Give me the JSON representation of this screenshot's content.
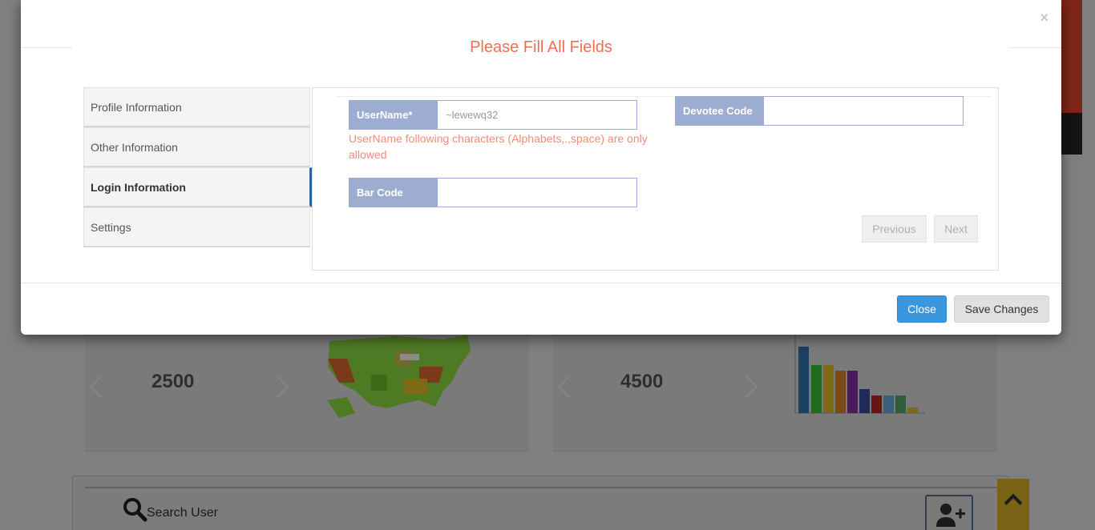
{
  "modal": {
    "title": "Please Fill All Fields",
    "close_x": "×",
    "tabs": [
      {
        "label": "Profile Information"
      },
      {
        "label": "Other Information"
      },
      {
        "label": "Login Information"
      },
      {
        "label": "Settings"
      }
    ],
    "active_tab": "Login Information",
    "fields": {
      "username": {
        "label": "UserName*",
        "value": "~lewewq32"
      },
      "devotee_code": {
        "label": "Devotee Code",
        "value": ""
      },
      "bar_code": {
        "label": "Bar Code",
        "value": ""
      }
    },
    "username_error": "UserName following characters (Alphabets,.,space) are only allowed",
    "previous_label": "Previous",
    "next_label": "Next",
    "close_label": "Close",
    "save_label": "Save Changes"
  },
  "background": {
    "stat_left": "2500",
    "stat_right": "4500",
    "search_label": "Search User"
  },
  "colors": {
    "title": "#f06e4f",
    "field_label_bg": "#9dadd2",
    "close_button": "#3a97dd",
    "error_text": "#f08c78",
    "active_tab_border": "#2e5f9e"
  }
}
